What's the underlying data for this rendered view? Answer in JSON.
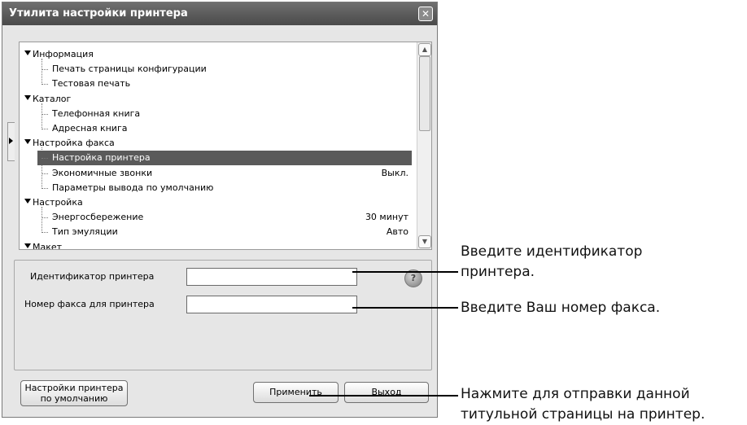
{
  "window": {
    "title": "Утилита настройки принтера",
    "close_label": "✕"
  },
  "tree": [
    {
      "label": "Информация",
      "value": "",
      "level": 0
    },
    {
      "label": "Печать страницы конфигурации",
      "value": "",
      "level": 1
    },
    {
      "label": "Тестовая печать",
      "value": "",
      "level": 1
    },
    {
      "label": "Каталог",
      "value": "",
      "level": 0
    },
    {
      "label": "Телефонная книга",
      "value": "",
      "level": 1
    },
    {
      "label": "Адресная книга",
      "value": "",
      "level": 1
    },
    {
      "label": "Настройка факса",
      "value": "",
      "level": 0
    },
    {
      "label": "Настройка принтера",
      "value": "",
      "level": 1,
      "selected": true
    },
    {
      "label": "Экономичные звонки",
      "value": "Выкл.",
      "level": 1
    },
    {
      "label": "Параметры вывода по умолчанию",
      "value": "",
      "level": 1
    },
    {
      "label": "Настройка",
      "value": "",
      "level": 0
    },
    {
      "label": "Энергосбережение",
      "value": "30 минут",
      "level": 1
    },
    {
      "label": "Тип эмуляции",
      "value": "Авто",
      "level": 1
    },
    {
      "label": "Макет",
      "value": "",
      "level": 0
    }
  ],
  "form": {
    "printer_id_label": "Идентификатор принтера",
    "printer_id_value": "",
    "fax_number_label": "Номер факса для принтера",
    "fax_number_value": ""
  },
  "buttons": {
    "defaults_line1": "Настройки принтера",
    "defaults_line2": "по умолчанию",
    "apply": "Применить",
    "exit": "Выход"
  },
  "annotations": {
    "id_line1": "Введите идентификатор",
    "id_line2": "принтера.",
    "fax": "Введите Ваш номер факса.",
    "apply_line1": "Нажмите для отправки данной",
    "apply_line2": "титульной страницы на принтер."
  },
  "colors": {
    "selection": "#5a5a5a",
    "titlebar": "#4a4a4a"
  }
}
